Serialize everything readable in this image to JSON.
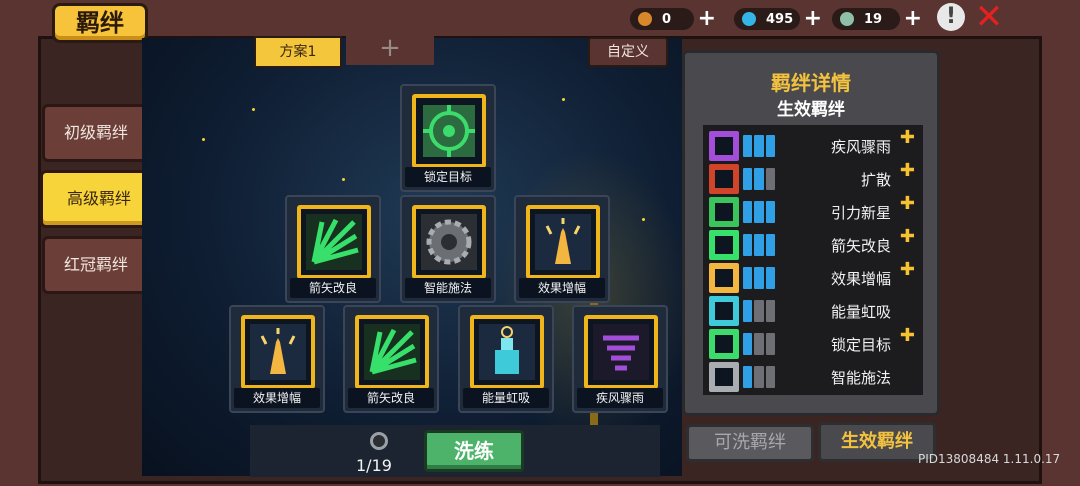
{
  "title": "羁绊",
  "resources": [
    {
      "icon": "coin-bag-icon",
      "value": "0",
      "color": "#d9872b"
    },
    {
      "icon": "gem-icon",
      "value": "495",
      "color": "#33b6e6"
    },
    {
      "icon": "gear-part-icon",
      "value": "19",
      "color": "#8fbfa6"
    }
  ],
  "plus_symbol": "+",
  "alert_symbol": "!",
  "close_symbol": "✕",
  "sidebar": {
    "items": [
      {
        "label": "初级羁绊"
      },
      {
        "label": "高级羁绊"
      },
      {
        "label": "红冠羁绊"
      }
    ]
  },
  "scheme": {
    "active": "方案1",
    "add": "+",
    "custom": "自定义"
  },
  "tree": {
    "nodes": [
      {
        "label": "锁定目标",
        "icon": "target-icon"
      },
      {
        "label": "箭矢改良",
        "icon": "arrows-icon"
      },
      {
        "label": "智能施法",
        "icon": "gear-icon"
      },
      {
        "label": "效果增幅",
        "icon": "praying-hands-icon"
      },
      {
        "label": "效果增幅",
        "icon": "praying-hands-icon"
      },
      {
        "label": "箭矢改良",
        "icon": "arrows-icon"
      },
      {
        "label": "能量虹吸",
        "icon": "potion-icon"
      },
      {
        "label": "疾风骤雨",
        "icon": "whirlwind-icon"
      }
    ]
  },
  "reroll": {
    "count": "1/19",
    "button": "洗练"
  },
  "panel": {
    "title": "羁绊详情",
    "subtitle": "生效羁绊",
    "rows": [
      {
        "name": "疾风骤雨",
        "icon": "whirlwind-icon",
        "filled": 3,
        "thumb": true
      },
      {
        "name": "扩散",
        "icon": "spread-icon",
        "filled": 2,
        "thumb": true
      },
      {
        "name": "引力新星",
        "icon": "gravity-icon",
        "filled": 3,
        "thumb": true
      },
      {
        "name": "箭矢改良",
        "icon": "arrows-icon",
        "filled": 3,
        "thumb": true
      },
      {
        "name": "效果增幅",
        "icon": "praying-hands-icon",
        "filled": 3,
        "thumb": true
      },
      {
        "name": "能量虹吸",
        "icon": "potion-icon",
        "filled": 1,
        "thumb": false
      },
      {
        "name": "锁定目标",
        "icon": "target-icon",
        "filled": 1,
        "thumb": true
      },
      {
        "name": "智能施法",
        "icon": "gear-icon",
        "filled": 1,
        "thumb": false
      }
    ],
    "tab_wash": "可洗羁绊",
    "tab_effective": "生效羁绊"
  },
  "thumb_symbol": "👍",
  "footer_id": "PID13808484 1.11.0.17"
}
